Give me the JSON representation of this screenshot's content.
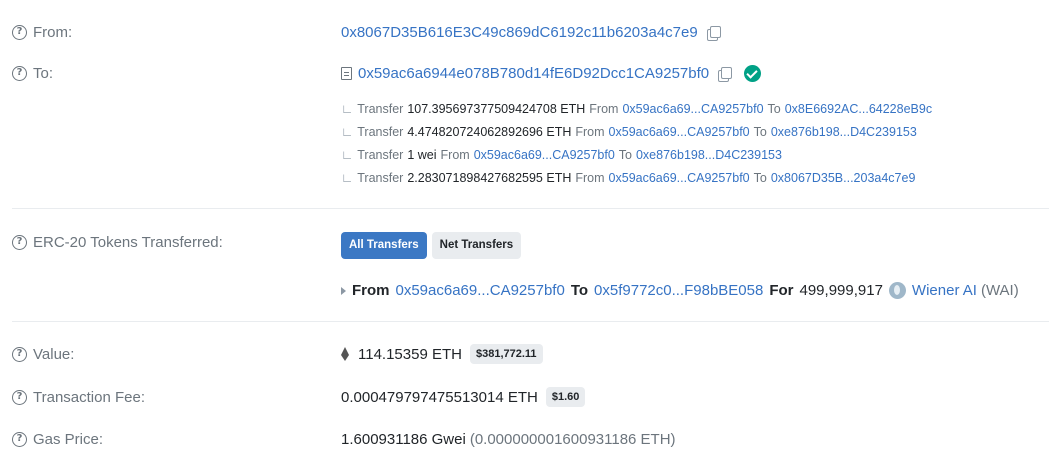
{
  "from": {
    "label": "From:",
    "address": "0x8067D35B616E3C49c869dC6192c11b6203a4c7e9"
  },
  "to": {
    "label": "To:",
    "address": "0x59ac6a6944e078B780d14fE6D92Dcc1CA9257bf0",
    "internal_transfers": [
      {
        "word": "Transfer",
        "amount": "107.395697377509424708 ETH",
        "from_word": "From",
        "from": "0x59ac6a69...CA9257bf0",
        "to_word": "To",
        "to": "0x8E6692AC...64228eB9c"
      },
      {
        "word": "Transfer",
        "amount": "4.474820724062892696 ETH",
        "from_word": "From",
        "from": "0x59ac6a69...CA9257bf0",
        "to_word": "To",
        "to": "0xe876b198...D4C239153"
      },
      {
        "word": "Transfer",
        "amount": "1 wei",
        "from_word": "From",
        "from": "0x59ac6a69...CA9257bf0",
        "to_word": "To",
        "to": "0xe876b198...D4C239153"
      },
      {
        "word": "Transfer",
        "amount": "2.283071898427682595 ETH",
        "from_word": "From",
        "from": "0x59ac6a69...CA9257bf0",
        "to_word": "To",
        "to": "0x8067D35B...203a4c7e9"
      }
    ]
  },
  "erc20": {
    "label": "ERC-20 Tokens Transferred:",
    "tab_all": "All Transfers",
    "tab_net": "Net Transfers",
    "transfer": {
      "from_word": "From",
      "from": "0x59ac6a69...CA9257bf0",
      "to_word": "To",
      "to": "0x5f9772c0...F98bBE058",
      "for_word": "For",
      "amount": "499,999,917",
      "token_name": "Wiener AI",
      "token_symbol": "(WAI)"
    }
  },
  "value": {
    "label": "Value:",
    "amount": "114.15359 ETH",
    "usd": "$381,772.11"
  },
  "fee": {
    "label": "Transaction Fee:",
    "amount": "0.000479797475513014 ETH",
    "usd": "$1.60"
  },
  "gas": {
    "label": "Gas Price:",
    "gwei": "1.600931186 Gwei",
    "eth": "(0.000000001600931186 ETH)"
  }
}
